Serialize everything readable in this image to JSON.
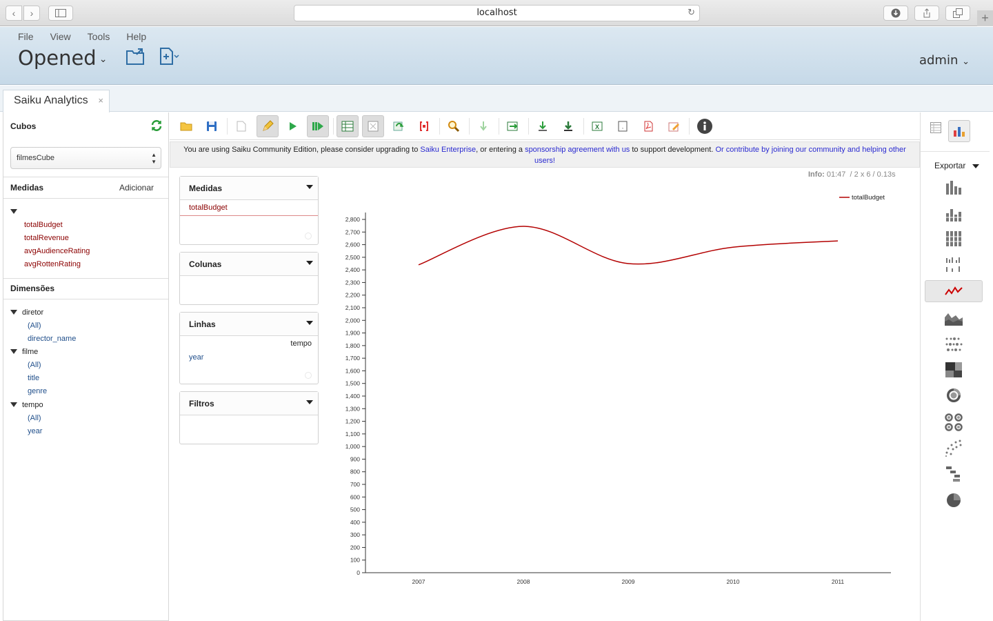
{
  "browser": {
    "url": "localhost"
  },
  "header": {
    "menu": [
      "File",
      "View",
      "Tools",
      "Help"
    ],
    "title": "Opened",
    "user": "admin"
  },
  "tab": {
    "label": "Saiku Analytics",
    "close": "×"
  },
  "sidebar": {
    "cubes_label": "Cubos",
    "cube_selected": "filmesCube",
    "measures_label": "Medidas",
    "add_label": "Adicionar",
    "measures": [
      "totalBudget",
      "totalRevenue",
      "avgAudienceRating",
      "avgRottenRating"
    ],
    "dimensions_label": "Dimensões",
    "dimensions": [
      {
        "name": "diretor",
        "levels": [
          "(All)",
          "director_name"
        ]
      },
      {
        "name": "filme",
        "levels": [
          "(All)",
          "title",
          "genre"
        ]
      },
      {
        "name": "tempo",
        "levels": [
          "(All)",
          "year"
        ]
      }
    ]
  },
  "notice": {
    "t1": "You are using Saiku Community Edition, please consider upgrading to ",
    "l1": "Saiku Enterprise",
    "t2": ", or entering a ",
    "l2": "sponsorship agreement with us",
    "t3": " to support development. ",
    "l3": "Or contribute by joining our community and helping other users!"
  },
  "panels": {
    "measures": {
      "title": "Medidas",
      "item": "totalBudget"
    },
    "columns": {
      "title": "Colunas"
    },
    "rows": {
      "title": "Linhas",
      "hierarchy": "tempo",
      "item": "year"
    },
    "filters": {
      "title": "Filtros"
    }
  },
  "info": {
    "label": "Info:",
    "text": "01:47  / 2 x 6 / 0.13s"
  },
  "export_label": "Exportar",
  "colors": {
    "line": "#b30000",
    "link": "#2a2ad0",
    "measure": "#8b0000"
  },
  "chart_data": {
    "type": "line",
    "x": [
      "2007",
      "2008",
      "2009",
      "2010",
      "2011"
    ],
    "series": [
      {
        "name": "totalBudget",
        "values": [
          2440,
          2745,
          2450,
          2580,
          2630
        ]
      }
    ],
    "ylim": [
      0,
      2800
    ],
    "yticks": [
      "0",
      "100",
      "200",
      "300",
      "400",
      "500",
      "600",
      "700",
      "800",
      "900",
      "1,000",
      "1,100",
      "1,200",
      "1,300",
      "1,400",
      "1,500",
      "1,600",
      "1,700",
      "1,800",
      "1,900",
      "2,000",
      "2,100",
      "2,200",
      "2,300",
      "2,400",
      "2,500",
      "2,600",
      "2,700",
      "2,800"
    ],
    "legend": "top-right",
    "grid": false
  }
}
